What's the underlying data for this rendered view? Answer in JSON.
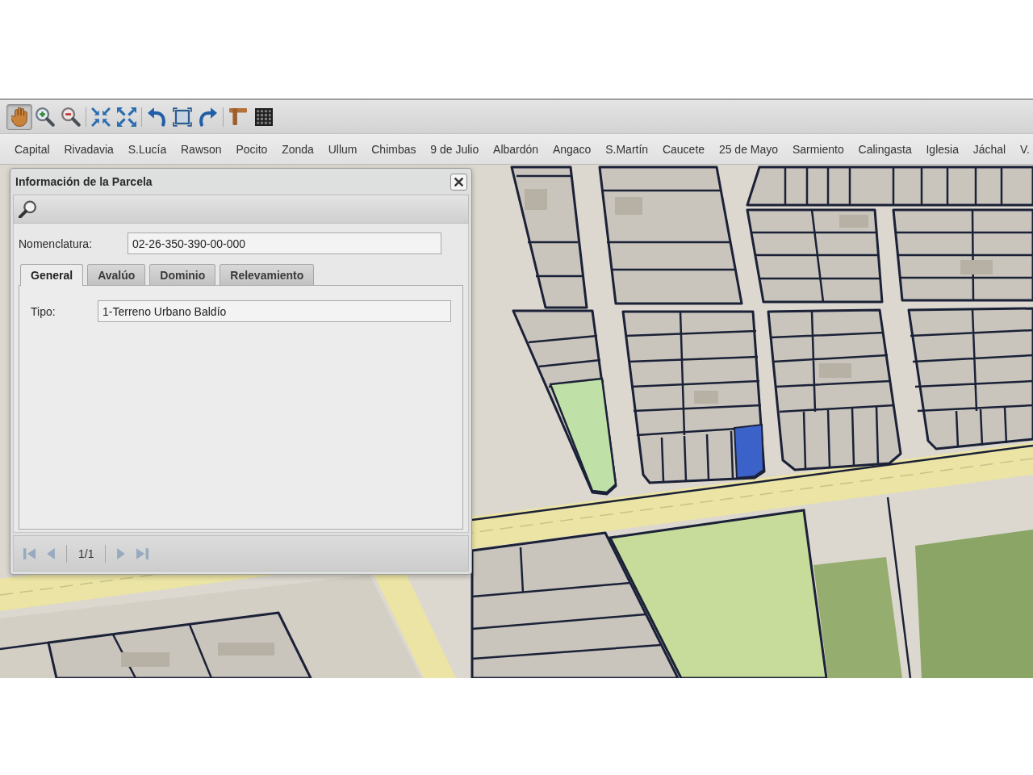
{
  "toolbar": {
    "groups": [
      {
        "tools": [
          {
            "kind": "pan",
            "selected": true
          },
          {
            "kind": "zoomin",
            "selected": false
          },
          {
            "kind": "zoomout",
            "selected": false
          }
        ]
      },
      {
        "tools": [
          {
            "kind": "fullextent",
            "selected": false
          },
          {
            "kind": "extent",
            "selected": false
          }
        ]
      },
      {
        "tools": [
          {
            "kind": "undo",
            "selected": false
          },
          {
            "kind": "zoombox",
            "selected": false
          },
          {
            "kind": "redo",
            "selected": false
          }
        ]
      },
      {
        "tools": [
          {
            "kind": "measure",
            "selected": false
          },
          {
            "kind": "grid",
            "selected": false
          }
        ]
      }
    ]
  },
  "districts": [
    "Capital",
    "Rivadavia",
    "S.Lucía",
    "Rawson",
    "Pocito",
    "Zonda",
    "Ullum",
    "Chimbas",
    "9 de Julio",
    "Albardón",
    "Angaco",
    "S.Martín",
    "Caucete",
    "25 de Mayo",
    "Sarmiento",
    "Calingasta",
    "Iglesia",
    "Jáchal",
    "V."
  ],
  "dialog": {
    "title": "Información de la Parcela",
    "nomenclatura": {
      "label": "Nomenclatura:",
      "value": "02-26-350-390-00-000"
    },
    "tabs": [
      {
        "label": "General",
        "selected": true
      },
      {
        "label": "Avalúo",
        "selected": false
      },
      {
        "label": "Dominio",
        "selected": false
      },
      {
        "label": "Relevamiento",
        "selected": false
      }
    ],
    "fields": [
      {
        "label": "Tipo:",
        "value": "1-Terreno Urbano Baldío"
      }
    ],
    "pager": {
      "back": [
        {
          "kind": "first",
          "disabled": true
        },
        {
          "kind": "previous",
          "disabled": true
        }
      ],
      "page": "1/1",
      "forward": [
        {
          "kind": "next",
          "disabled": true
        },
        {
          "kind": "last",
          "disabled": true
        }
      ]
    }
  }
}
